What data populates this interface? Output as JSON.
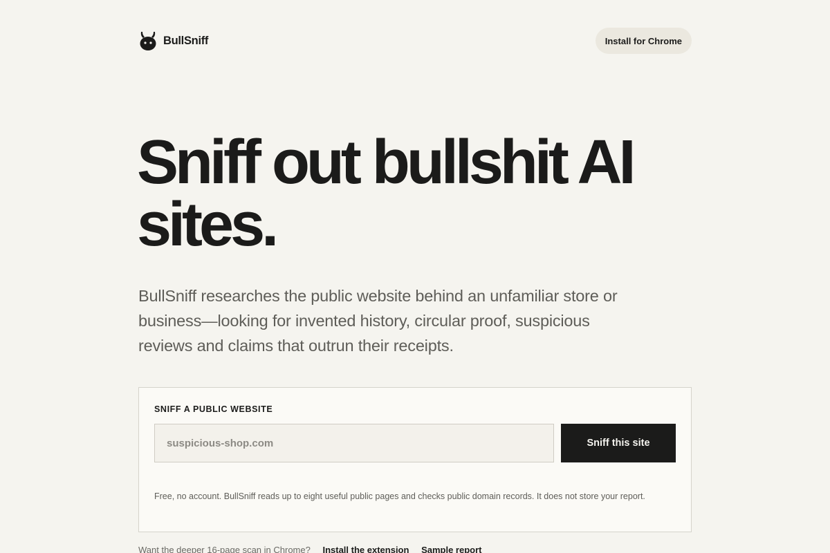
{
  "header": {
    "brand_name": "BullSniff",
    "logo_icon": "bull-head-icon",
    "install_label": "Install for Chrome"
  },
  "hero": {
    "title_line1": "Sniff out bullshit AI",
    "title_line2": "sites.",
    "subtitle": "BullSniff researches the public website behind an unfamiliar store or business—looking for invented history, circular proof, suspicious reviews and claims that outrun their receipts."
  },
  "form": {
    "label": "SNIFF A PUBLIC WEBSITE",
    "url_placeholder": "suspicious-shop.com",
    "url_value": "",
    "submit_label": "Sniff this site",
    "note": "Free, no account. BullSniff reads up to eight useful public pages and checks public domain records. It does not store your report."
  },
  "below": {
    "prompt": "Want the deeper 16-page scan in Chrome?",
    "install_link": "Install the extension",
    "sample_link": "Sample report"
  },
  "colors": {
    "background": "#f5f4ef",
    "text": "#1b1b1a",
    "button_dark": "#1b1b1a",
    "pill_bg": "#ebe8df"
  }
}
